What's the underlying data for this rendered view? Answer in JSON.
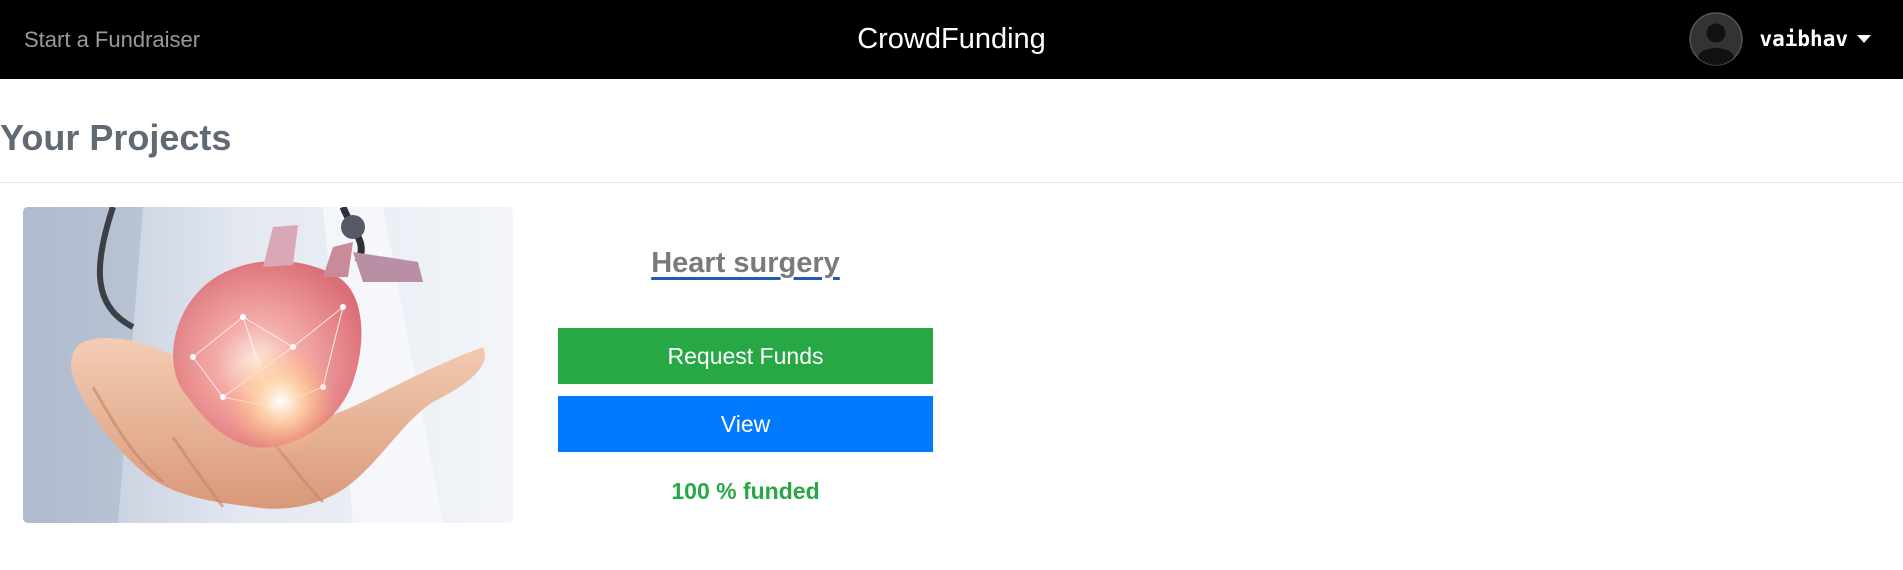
{
  "navbar": {
    "start_link": "Start a Fundraiser",
    "brand": "CrowdFunding",
    "user": {
      "name": "vaibhav",
      "avatar_icon": "user-circle-icon",
      "menu_icon": "caret-down-icon"
    }
  },
  "page": {
    "title": "Your Projects"
  },
  "projects": [
    {
      "title": "Heart surgery",
      "image_icon": "heart-in-hands-image",
      "request_label": "Request Funds",
      "view_label": "View",
      "funded_text": "100 % funded"
    }
  ],
  "colors": {
    "navbar_bg": "#000000",
    "success": "#28a745",
    "primary": "#007bff",
    "heading": "#5f6a75"
  }
}
